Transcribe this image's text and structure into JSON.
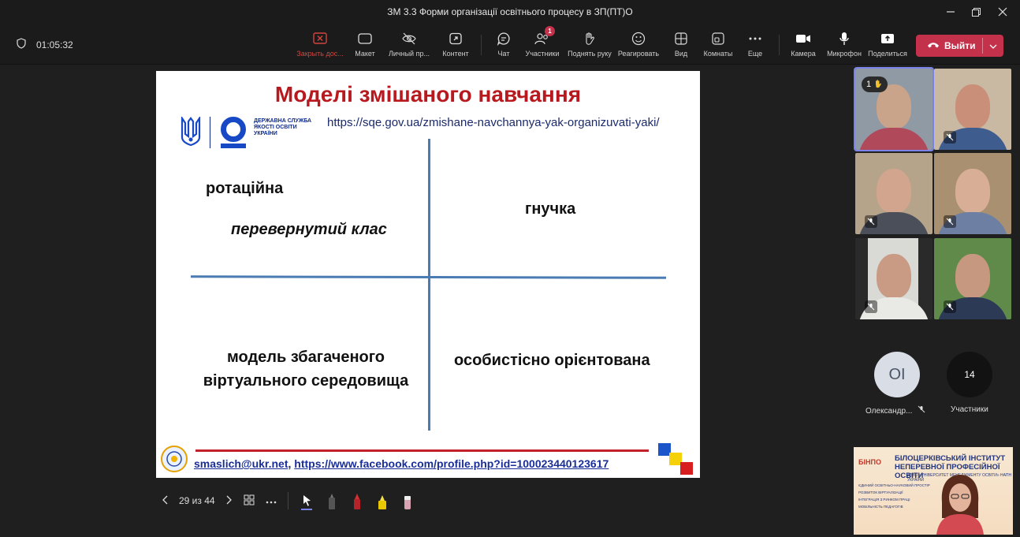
{
  "window": {
    "title": "ЗМ 3.3 Форми організації освітнього процесу в ЗП(ПТ)О"
  },
  "meeting": {
    "elapsed": "01:05:32"
  },
  "toolbar": {
    "stop_share_label": "Закрыть дос...",
    "layout_label": "Макет",
    "personal_label": "Личный пр...",
    "content_label": "Контент",
    "chat_label": "Чат",
    "participants_label": "Участники",
    "participants_badge": "1",
    "raise_hand_label": "Поднять руку",
    "react_label": "Реагировать",
    "view_label": "Вид",
    "rooms_label": "Комнаты",
    "more_label": "Еще",
    "camera_label": "Камера",
    "mic_label": "Микрофон",
    "share_label": "Поделиться",
    "leave_label": "Выйти"
  },
  "slide": {
    "title": "Моделі змішаного навчання",
    "org_name": "ДЕРЖАВНА СЛУЖБА ЯКОСТІ ОСВІТИ УКРАЇНИ",
    "url": "https://sqe.gov.ua/zmishane-navchannya-yak-organizuvati-yaki/",
    "q_rotation": "ротаційна",
    "q_flipped": "перевернутий клас",
    "q_flex": "гнучка",
    "q_enriched_line1": "модель збагаченого",
    "q_enriched_line2": "віртуального середовища",
    "q_personal": "особистісно орієнтована",
    "footer_email": "smaslich@ukr.net",
    "footer_comma": ",",
    "footer_link": "https://www.facebook.com/profile.php?id=100023440123617"
  },
  "slide_controls": {
    "counter": "29 из 44"
  },
  "participants": {
    "hand_count": "1",
    "avatar_initials": "OI",
    "avatar_name": "Олександр...",
    "count": "14",
    "count_label": "Участники"
  },
  "banner": {
    "logo_text": "БІНПО",
    "title": "БІЛОЦЕРКІВСЬКИЙ ІНСТИТУТ НЕПЕРЕВНОЇ ПРОФЕСІЙНОЇ ОСВІТИ",
    "subtitle": "ДЗВО «УНІВЕРСИТЕТ МЕНЕДЖМЕНТУ ОСВІТИ» НАПН УКРАЇНИ",
    "items": [
      "ЄДИНИЙ ОСВІТНЬО-НАУКОВИЙ ПРОСТІР",
      "РОЗВИТОК ВІРТУАЛІЗАЦІЇ",
      "ІНТЕГРАЦІЯ З РИНКОМ ПРАЦІ",
      "МОБІЛЬНІСТЬ ПЕДАГОГІВ"
    ]
  },
  "colors": {
    "accent": "#7b83eb",
    "leave": "#c4314b",
    "slide_title": "#b8191e",
    "quadrant_lines": "#4a7bb3"
  }
}
